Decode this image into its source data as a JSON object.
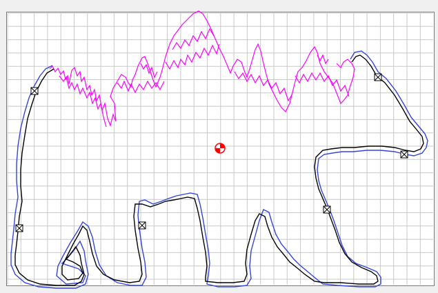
{
  "canvas": {
    "background": "#ffffff",
    "grid_color": "#c8c8c8",
    "frame_color": "#7a7a7a"
  },
  "paths": {
    "outer_cut_color": "#3344dd",
    "inner_cut_color": "#000000",
    "tree_color": "#ff00ff"
  },
  "markers": {
    "node_marker_icon": "crossed-box-icon",
    "origin_marker_icon": "crosshair-target-icon",
    "origin_color": "#ff0000"
  }
}
